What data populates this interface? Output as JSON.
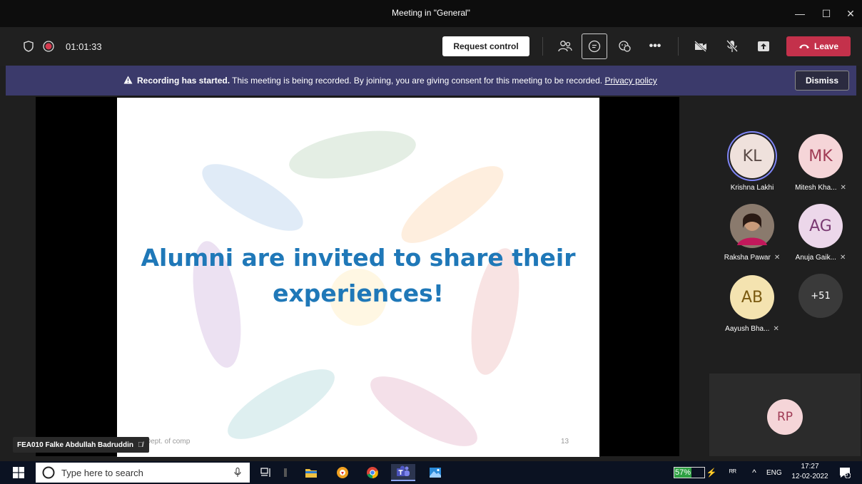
{
  "window": {
    "title": "Meeting in \"General\""
  },
  "toolbar": {
    "timer": "01:01:33",
    "request_control": "Request control",
    "leave": "Leave"
  },
  "banner": {
    "bold": "Recording has started.",
    "text": " This meeting is being recorded. By joining, you are giving consent for this meeting to be recorded. ",
    "link": "Privacy policy",
    "dismiss": "Dismiss"
  },
  "slide": {
    "line1": "Alumni are invited to share their",
    "line2": "experiences!",
    "footer_left": "Dept. of comp",
    "page_number": "13"
  },
  "presenter": {
    "name": "FEA010 Falke Abdullah Badruddin"
  },
  "participants": [
    {
      "initials": "KL",
      "name": "Krishna Lakhi",
      "muted": false,
      "bg": "#efe1dc",
      "fg": "#5a4a46"
    },
    {
      "initials": "MK",
      "name": "Mitesh Kha...",
      "muted": true,
      "bg": "#f5d5d8",
      "fg": "#a03b55"
    },
    {
      "initials": "",
      "name": "Raksha Pawar",
      "muted": true,
      "bg": "#8a7a6d",
      "fg": "#fff"
    },
    {
      "initials": "AG",
      "name": "Anuja Gaik...",
      "muted": true,
      "bg": "#ecd7ea",
      "fg": "#7a3a72"
    },
    {
      "initials": "AB",
      "name": "Aayush Bha...",
      "muted": true,
      "bg": "#f4e3b0",
      "fg": "#7a5a10"
    },
    {
      "initials": "+51",
      "name": "",
      "muted": false,
      "bg": "#3a3a3a",
      "fg": "#fff"
    }
  ],
  "self": {
    "initials": "RP"
  },
  "taskbar": {
    "search_placeholder": "Type here to search",
    "battery": "57%",
    "lang": "ENG",
    "time": "17:27",
    "date": "12-02-2022",
    "notifications": "3"
  },
  "colors": {
    "leave": "#c4314b",
    "banner": "#3b3a6b",
    "headline": "#1f78b8",
    "battery": "#2ea043"
  }
}
